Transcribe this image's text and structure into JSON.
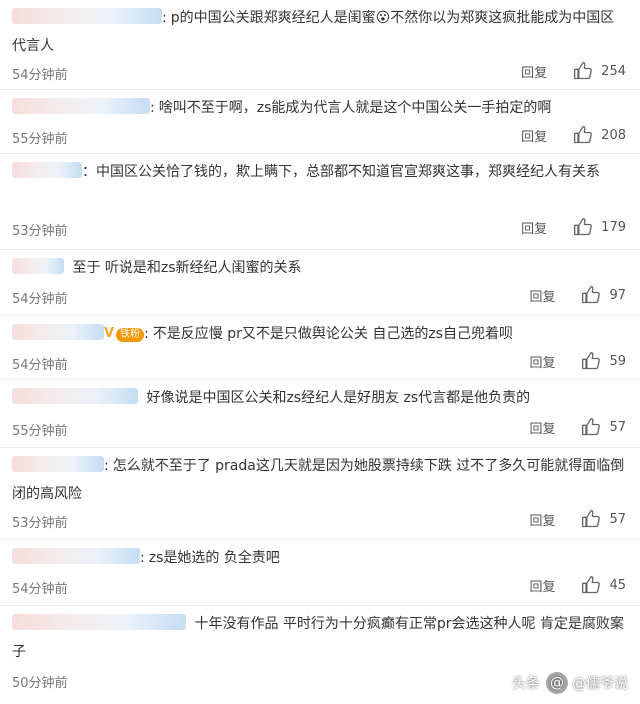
{
  "reply_label": "回复",
  "watermark": {
    "logo": "头条",
    "handle": "@儒爷说"
  },
  "comments": [
    {
      "text": "p的中国公关跟郑爽经纪人是闺蜜😮不然你以为郑爽这疯批能成为中国区代言人",
      "time": "54分钟前",
      "likes": "254"
    },
    {
      "text": "啥叫不至于啊，zs能成为代言人就是这个中国公关一手拍定的啊",
      "time": "55分钟前",
      "likes": "208"
    },
    {
      "text": "：中国区公关恰了钱的，欺上瞒下，总部都不知道官宣郑爽这事，郑爽经纪人有关系",
      "time": "53分钟前",
      "likes": "179"
    },
    {
      "text": "至于 听说是和zs新经纪人闺蜜的关系",
      "time": "54分钟前",
      "likes": "97"
    },
    {
      "badge": "铁粉",
      "text": "不是反应慢 pr又不是只做舆论公关 自己选的zs自己兜着呗",
      "time": "54分钟前",
      "likes": "59"
    },
    {
      "text": "好像说是中国区公关和zs经纪人是好朋友 zs代言都是他负责的",
      "time": "55分钟前",
      "likes": "57"
    },
    {
      "text": "怎么就不至于了 prada这几天就是因为她股票持续下跌 过不了多久可能就得面临倒闭的高风险",
      "time": "53分钟前",
      "likes": "57"
    },
    {
      "text": "zs是她选的 负全责吧",
      "time": "54分钟前",
      "likes": "45"
    },
    {
      "text": "十年没有作品 平时行为十分疯癫有正常pr会选这种人呢 肯定是腐败案子",
      "time": "50分钟前",
      "likes": ""
    }
  ]
}
